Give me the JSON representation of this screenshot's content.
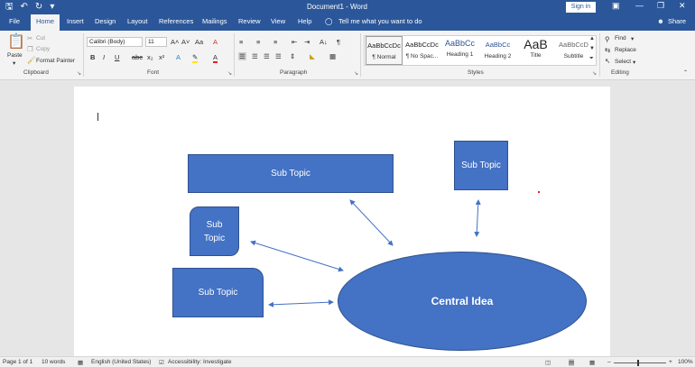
{
  "titlebar": {
    "title": "Document1 - Word",
    "sign_in": "Sign in",
    "qat_icons": [
      "save-icon",
      "undo-icon",
      "redo-icon",
      "customize-icon"
    ],
    "window_icons": [
      "ribbon-display-icon",
      "minimize-icon",
      "restore-icon",
      "close-icon"
    ]
  },
  "tabs": {
    "items": [
      "File",
      "Home",
      "Insert",
      "Design",
      "Layout",
      "References",
      "Mailings",
      "Review",
      "View",
      "Help"
    ],
    "active": "Home",
    "tell_me": "Tell me what you want to do",
    "share": "Share"
  },
  "ribbon": {
    "clipboard": {
      "label": "Clipboard",
      "paste": "Paste",
      "cut": "Cut",
      "copy": "Copy",
      "format_painter": "Format Painter"
    },
    "font": {
      "label": "Font",
      "family": "Calibri (Body)",
      "size": "11",
      "grow": "A˄",
      "shrink": "A˅",
      "case": "Aa",
      "clear": "A",
      "bold": "B",
      "italic": "I",
      "underline": "U",
      "strike": "abc",
      "subscript": "x₂",
      "superscript": "x²",
      "effects": "A",
      "highlight": "✎",
      "color": "A"
    },
    "paragraph": {
      "label": "Paragraph",
      "pilcrow": "¶",
      "sort": "A↓"
    },
    "styles": {
      "label": "Styles",
      "items": [
        {
          "preview": "AaBbCcDc",
          "name": "¶ Normal"
        },
        {
          "preview": "AaBbCcDc",
          "name": "¶ No Spac..."
        },
        {
          "preview": "AaBbCc",
          "name": "Heading 1"
        },
        {
          "preview": "AaBbCc",
          "name": "Heading 2"
        },
        {
          "preview": "AaB",
          "name": "Title"
        },
        {
          "preview": "AaBbCcD",
          "name": "Subtitle"
        }
      ]
    },
    "editing": {
      "label": "Editing",
      "find": "Find",
      "replace": "Replace",
      "select": "Select"
    }
  },
  "document": {
    "shapes": [
      {
        "text": "Sub Topic"
      },
      {
        "text": "Sub Topic"
      },
      {
        "text": "Sub Topic"
      },
      {
        "text": "Sub Topic"
      }
    ],
    "central": "Central Idea",
    "colors": {
      "shape_fill": "#4472c4",
      "shape_border": "#2f528f",
      "arrow": "#4472c4"
    }
  },
  "statusbar": {
    "page": "Page 1 of 1",
    "words": "10 words",
    "language": "English (United States)",
    "accessibility": "Accessibility: Investigate",
    "zoom": "100%",
    "minus": "–",
    "plus": "+"
  },
  "colors": {
    "title_bg": "#2b579a",
    "ribbon_bg": "#f3f3f3"
  }
}
